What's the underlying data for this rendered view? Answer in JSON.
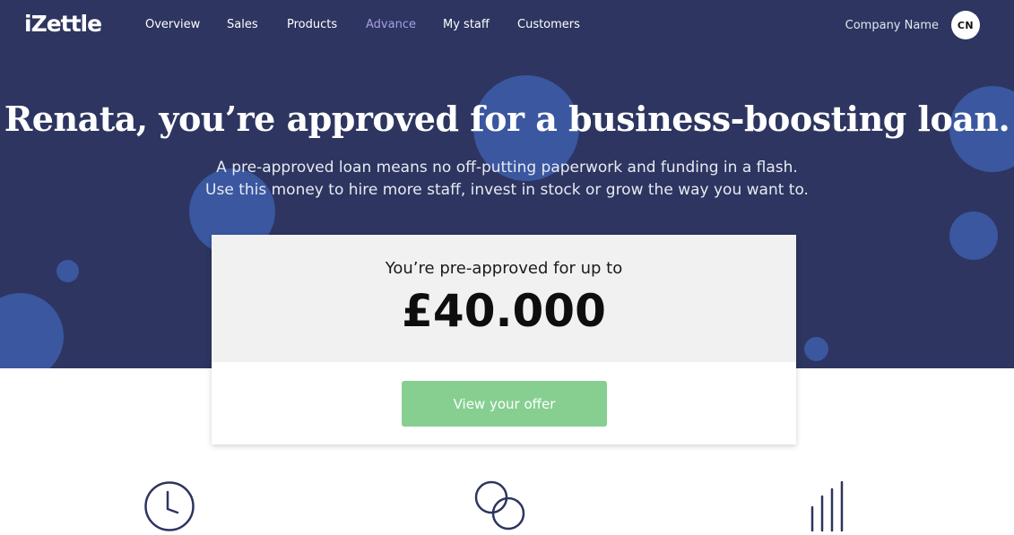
{
  "brand": {
    "logo": "iZettle"
  },
  "nav": {
    "items": [
      {
        "label": "Overview",
        "active": false
      },
      {
        "label": "Sales",
        "active": false
      },
      {
        "label": "Products",
        "active": false
      },
      {
        "label": "Advance",
        "active": true
      },
      {
        "label": "My staff",
        "active": false
      },
      {
        "label": "Customers",
        "active": false
      }
    ],
    "company_name": "Company Name",
    "avatar_initials": "CN"
  },
  "hero": {
    "headline": "Renata, you’re approved for a business-boosting loan.",
    "subtitle_line1": "A pre-approved loan means no off-putting paperwork and funding in a flash.",
    "subtitle_line2": "Use this money to hire more staff, invest in stock or grow the way you want to."
  },
  "offer_card": {
    "label": "You’re pre-approved for up to",
    "amount": "£40.000",
    "button_label": "View your offer"
  },
  "features": [
    {
      "icon": "clock-icon"
    },
    {
      "icon": "coins-icon"
    },
    {
      "icon": "bars-icon"
    }
  ],
  "colors": {
    "hero_bg": "#2d3560",
    "bubble": "#3a57a0",
    "accent_nav": "#a89fe6",
    "cta_green": "#86cf91",
    "icon_navy": "#2d3560"
  }
}
